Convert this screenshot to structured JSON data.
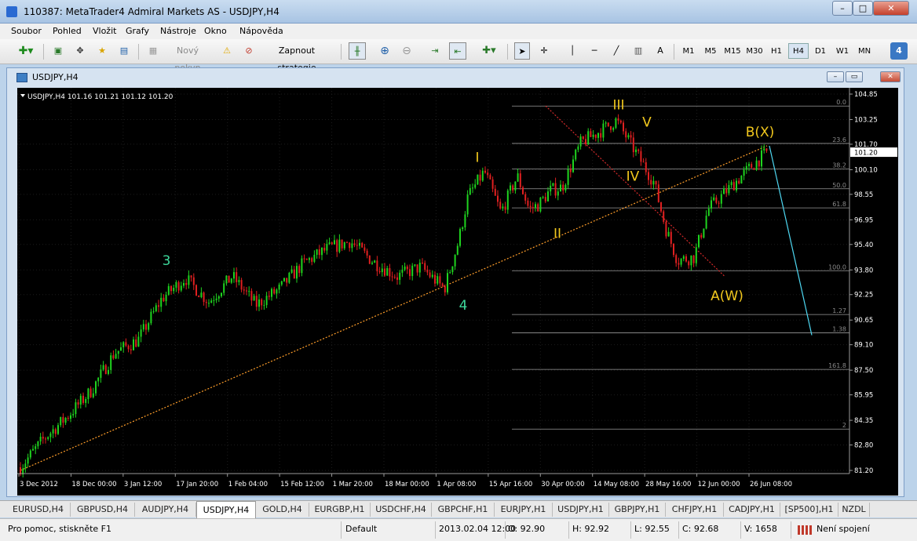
{
  "window": {
    "title": "110387: MetaTrader4 Admiral Markets AS - USDJPY,H4",
    "minimize": "–",
    "maximize": "□",
    "close": "✕"
  },
  "menu": [
    "Soubor",
    "Pohled",
    "Vložit",
    "Grafy",
    "Nástroje",
    "Okno",
    "Nápověda"
  ],
  "toolbar": {
    "new_order": "Nový pokyn",
    "autotrading": "Zapnout strategie",
    "text_tool": "A",
    "timeframes": [
      "M1",
      "M5",
      "M15",
      "M30",
      "H1",
      "H4",
      "D1",
      "W1",
      "MN"
    ],
    "active_timeframe": "H4",
    "badge": "4"
  },
  "chart_window": {
    "title": "USDJPY,H4",
    "minimize": "–",
    "restore": "▭",
    "close": "✕"
  },
  "chart_data": {
    "type": "candlestick",
    "symbol": "USDJPY,H4",
    "header": "USDJPY,H4  101.16 101.21 101.12 101.20",
    "current_price": "101.20",
    "ylim": [
      81.2,
      104.85
    ],
    "y_ticks": [
      "104.85",
      "103.25",
      "101.70",
      "100.10",
      "98.55",
      "96.95",
      "95.40",
      "93.80",
      "92.25",
      "90.65",
      "89.10",
      "87.50",
      "85.95",
      "84.35",
      "82.80",
      "81.20"
    ],
    "x_labels": [
      "3 Dec 2012",
      "18 Dec 00:00",
      "3 Jan 12:00",
      "17 Jan 20:00",
      "1 Feb 04:00",
      "15 Feb 12:00",
      "1 Mar 20:00",
      "18 Mar 00:00",
      "1 Apr 08:00",
      "15 Apr 16:00",
      "30 Apr 00:00",
      "14 May 08:00",
      "28 May 16:00",
      "12 Jun 00:00",
      "26 Jun 08:00"
    ],
    "price_path": [
      [
        0,
        81.4
      ],
      [
        0.05,
        83.2
      ],
      [
        0.1,
        84.6
      ],
      [
        0.15,
        86.2
      ],
      [
        0.2,
        88.6
      ],
      [
        0.25,
        89.4
      ],
      [
        0.3,
        92.0
      ],
      [
        0.35,
        93.3
      ],
      [
        0.4,
        91.8
      ],
      [
        0.45,
        93.4
      ],
      [
        0.5,
        91.6
      ],
      [
        0.55,
        92.6
      ],
      [
        0.6,
        94.2
      ],
      [
        0.65,
        95.1
      ],
      [
        0.7,
        95.6
      ],
      [
        0.75,
        94.3
      ],
      [
        0.8,
        93.4
      ],
      [
        0.85,
        94.0
      ],
      [
        0.9,
        92.6
      ],
      [
        0.93,
        95.6
      ],
      [
        0.95,
        98.4
      ],
      [
        0.985,
        100.0
      ],
      [
        1.02,
        97.4
      ],
      [
        1.055,
        99.7
      ],
      [
        1.08,
        97.6
      ],
      [
        1.1,
        97.9
      ],
      [
        1.125,
        98.8
      ],
      [
        1.15,
        99.0
      ],
      [
        1.19,
        101.8
      ],
      [
        1.235,
        102.6
      ],
      [
        1.265,
        103.2
      ],
      [
        1.3,
        101.5
      ],
      [
        1.345,
        99.3
      ],
      [
        1.37,
        96.4
      ],
      [
        1.395,
        94.4
      ],
      [
        1.43,
        94.6
      ],
      [
        1.46,
        97.6
      ],
      [
        1.51,
        99.1
      ],
      [
        1.555,
        100.4
      ],
      [
        1.585,
        101.2
      ]
    ],
    "wave_labels": [
      {
        "text": "3",
        "price": 94.1,
        "idx": 0.31,
        "color": "#3dd89b"
      },
      {
        "text": "4",
        "price": 91.3,
        "idx": 0.94,
        "color": "#3dd89b"
      },
      {
        "text": "I",
        "price": 100.6,
        "idx": 0.97,
        "color": "#f2c81d"
      },
      {
        "text": "II",
        "price": 95.8,
        "idx": 1.14,
        "color": "#f2c81d"
      },
      {
        "text": "III",
        "price": 103.9,
        "idx": 1.27,
        "color": "#f2c81d"
      },
      {
        "text": "IV",
        "price": 99.4,
        "idx": 1.3,
        "color": "#f2c81d"
      },
      {
        "text": "V",
        "price": 102.8,
        "idx": 1.33,
        "color": "#f2c81d"
      },
      {
        "text": "A(W)",
        "price": 91.9,
        "idx": 1.5,
        "color": "#f2c81d"
      },
      {
        "text": "B(X)",
        "price": 102.2,
        "idx": 1.57,
        "color": "#f2c81d"
      }
    ],
    "fib_levels": [
      {
        "label": "0.0",
        "price": 104.1
      },
      {
        "label": "23.6",
        "price": 101.75
      },
      {
        "label": "38.2",
        "price": 100.15
      },
      {
        "label": "50.0",
        "price": 98.9
      },
      {
        "label": "61.8",
        "price": 97.7
      },
      {
        "label": "100.0",
        "price": 93.75
      },
      {
        "label": "1.27",
        "price": 91.0
      },
      {
        "label": "1.38",
        "price": 89.85
      },
      {
        "label": "161.8",
        "price": 87.55
      },
      {
        "label": "2",
        "price": 83.8
      }
    ],
    "trendlines": [
      {
        "type": "dotted",
        "color": "#ff9e2a",
        "from": [
          0,
          81.2
        ],
        "to": [
          1.585,
          101.6
        ]
      },
      {
        "type": "dotted",
        "color": "#d42a2a",
        "from": [
          1.115,
          104.1
        ],
        "to": [
          1.495,
          93.4
        ]
      },
      {
        "type": "solid",
        "color": "#4ed8f2",
        "from": [
          1.59,
          101.6
        ],
        "to": [
          1.68,
          89.7
        ]
      }
    ]
  },
  "symbol_tabs": [
    "EURUSD,H4",
    "GBPUSD,H4",
    "AUDJPY,H4",
    "USDJPY,H4",
    "GOLD,H4",
    "EURGBP,H1",
    "USDCHF,H4",
    "GBPCHF,H1",
    "EURJPY,H1",
    "USDJPY,H1",
    "GBPJPY,H1",
    "CHFJPY,H1",
    "CADJPY,H1",
    "[SP500],H1",
    "NZDL"
  ],
  "active_tab": "USDJPY,H4",
  "status": {
    "help": "Pro pomoc, stiskněte F1",
    "profile": "Default",
    "datetime": "2013.02.04 12:00",
    "open": "O: 92.90",
    "high": "H: 92.92",
    "low": "L: 92.55",
    "close": "C: 92.68",
    "volume": "V: 1658",
    "connection": "Není spojení"
  }
}
